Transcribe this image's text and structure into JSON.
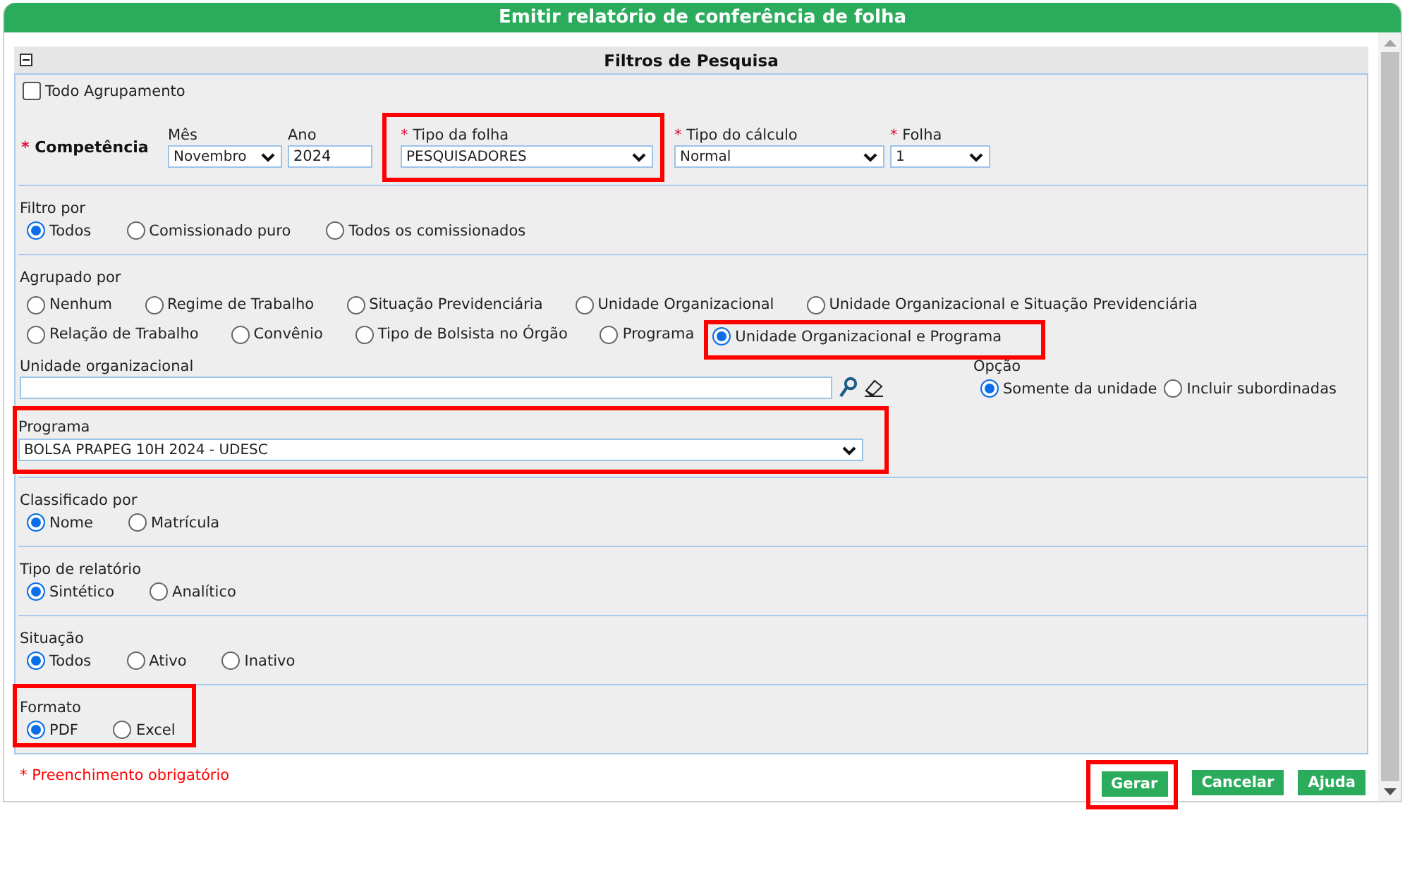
{
  "dialog": {
    "title": "Emitir relatório de conferência de folha"
  },
  "panel": {
    "title": "Filtros de Pesquisa",
    "expanded": true
  },
  "required_mark": "*",
  "todo_agrupamento": {
    "label": "Todo Agrupamento",
    "checked": false
  },
  "competencia": {
    "label": "Competência",
    "required": true,
    "fields": [
      {
        "label": "Mês",
        "kind": "select",
        "value": "Novembro",
        "required": false,
        "highlighted": false
      },
      {
        "label": "Ano",
        "kind": "text",
        "value": "2024",
        "required": false,
        "highlighted": false
      },
      {
        "label": "Tipo da folha",
        "kind": "select",
        "value": "PESQUISADORES",
        "required": true,
        "highlighted": true
      },
      {
        "label": "Tipo do cálculo",
        "kind": "select",
        "value": "Normal",
        "required": true,
        "highlighted": false
      },
      {
        "label": "Folha",
        "kind": "select",
        "value": "1",
        "required": true,
        "highlighted": false
      }
    ]
  },
  "filtro_por": {
    "label": "Filtro por",
    "options": [
      {
        "label": "Todos",
        "selected": true
      },
      {
        "label": "Comissionado puro",
        "selected": false
      },
      {
        "label": "Todos os comissionados",
        "selected": false
      }
    ]
  },
  "agrupado_por": {
    "label": "Agrupado por",
    "rows": [
      [
        {
          "label": "Nenhum",
          "selected": false,
          "highlighted": false
        },
        {
          "label": "Regime de Trabalho",
          "selected": false,
          "highlighted": false
        },
        {
          "label": "Situação Previdenciária",
          "selected": false,
          "highlighted": false
        },
        {
          "label": "Unidade Organizacional",
          "selected": false,
          "highlighted": false
        },
        {
          "label": "Unidade Organizacional e Situação Previdenciária",
          "selected": false,
          "highlighted": false
        }
      ],
      [
        {
          "label": "Relação de Trabalho",
          "selected": false,
          "highlighted": false
        },
        {
          "label": "Convênio",
          "selected": false,
          "highlighted": false
        },
        {
          "label": "Tipo de Bolsista no Órgão",
          "selected": false,
          "highlighted": false
        },
        {
          "label": "Programa",
          "selected": false,
          "highlighted": false
        },
        {
          "label": "Unidade Organizacional e Programa",
          "selected": true,
          "highlighted": true
        }
      ]
    ]
  },
  "unidade_organizacional": {
    "label": "Unidade organizacional"
  },
  "opcao": {
    "label": "Opção",
    "options": [
      {
        "label": "Somente da unidade",
        "selected": true
      },
      {
        "label": "Incluir subordinadas",
        "selected": false
      }
    ]
  },
  "programa": {
    "label": "Programa",
    "value": "BOLSA PRAPEG 10H 2024 - UDESC",
    "highlighted": true
  },
  "classificado_por": {
    "label": "Classificado por",
    "options": [
      {
        "label": "Nome",
        "selected": true
      },
      {
        "label": "Matrícula",
        "selected": false
      }
    ]
  },
  "tipo_de_relatorio": {
    "label": "Tipo de relatório",
    "options": [
      {
        "label": "Sintético",
        "selected": true
      },
      {
        "label": "Analítico",
        "selected": false
      }
    ]
  },
  "situacao": {
    "label": "Situação",
    "options": [
      {
        "label": "Todos",
        "selected": true
      },
      {
        "label": "Ativo",
        "selected": false
      },
      {
        "label": "Inativo",
        "selected": false
      }
    ]
  },
  "formato": {
    "label": "Formato",
    "highlighted": true,
    "options": [
      {
        "label": "PDF",
        "selected": true
      },
      {
        "label": "Excel",
        "selected": false
      }
    ]
  },
  "required_note": "* Preenchimento obrigatório",
  "buttons": [
    {
      "label": "Gerar",
      "highlighted": true
    },
    {
      "label": "Cancelar",
      "highlighted": false
    },
    {
      "label": "Ajuda",
      "highlighted": false
    }
  ]
}
